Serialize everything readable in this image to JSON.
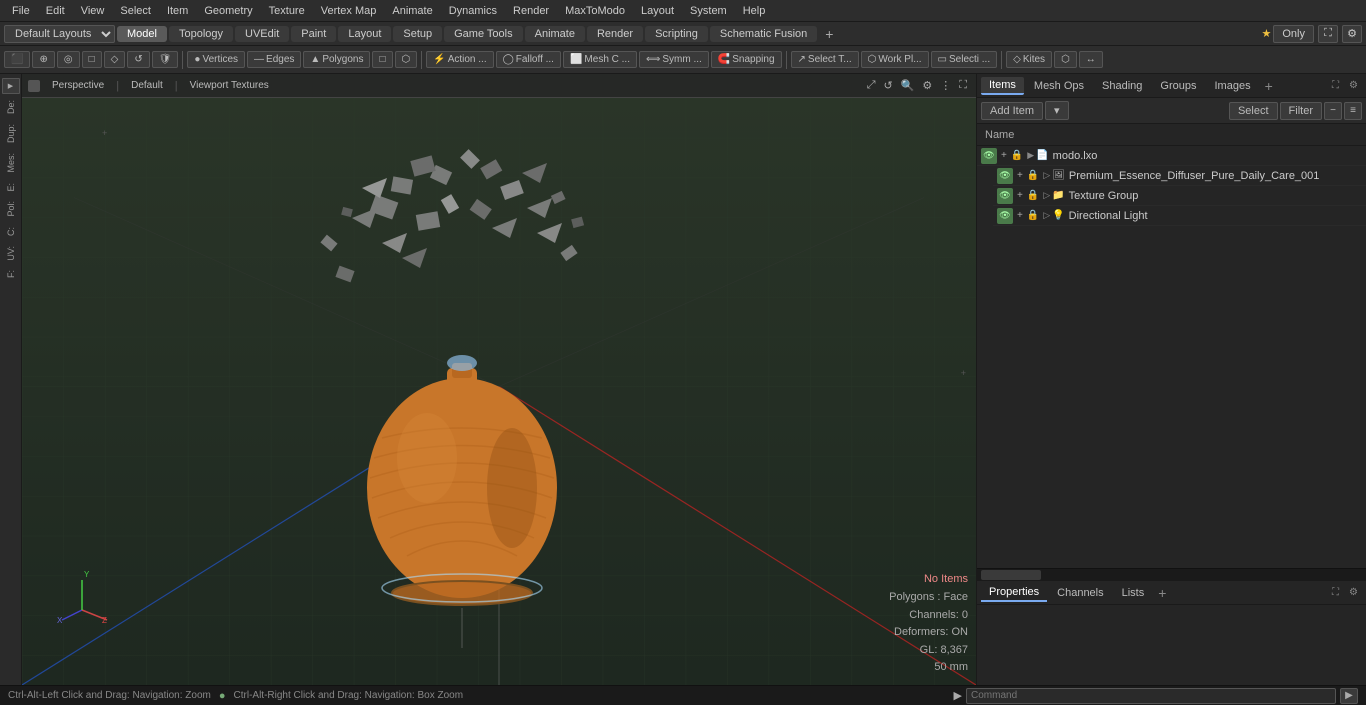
{
  "menu": {
    "items": [
      "File",
      "Edit",
      "View",
      "Select",
      "Item",
      "Geometry",
      "Texture",
      "Vertex Map",
      "Animate",
      "Dynamics",
      "Render",
      "MaxToModo",
      "Layout",
      "System",
      "Help"
    ]
  },
  "layout_bar": {
    "dropdown_label": "Default Layouts ▾",
    "tabs": [
      "Model",
      "Topology",
      "UVEdit",
      "Paint",
      "Layout",
      "Setup",
      "Game Tools",
      "Animate",
      "Render",
      "Scripting",
      "Schematic Fusion"
    ],
    "active_tab": "Model",
    "add_icon": "+",
    "star_label": "★ Only"
  },
  "toolbar": {
    "buttons": [
      {
        "label": "⬛",
        "icon": "selection-icon"
      },
      {
        "label": "⊕",
        "icon": "snapping-icon"
      },
      {
        "label": "◇",
        "icon": "falloff-icon"
      },
      {
        "label": "▭",
        "icon": "workplane-icon"
      },
      {
        "label": "Vertices",
        "icon": "vertices-icon",
        "active": false
      },
      {
        "label": "Edges",
        "icon": "edges-icon",
        "active": false
      },
      {
        "label": "Polygons",
        "icon": "polygons-icon",
        "active": false
      },
      {
        "label": "▢",
        "icon": "mode-icon"
      },
      {
        "label": "⬡",
        "icon": "mode2-icon"
      },
      {
        "label": "⊞",
        "icon": "mode3-icon"
      },
      {
        "label": "Action ...",
        "icon": "action-icon"
      },
      {
        "label": "Falloff ...",
        "icon": "falloff-dropdown-icon"
      },
      {
        "label": "Mesh C ...",
        "icon": "mesh-icon"
      },
      {
        "label": "Symm ...",
        "icon": "symmetry-icon"
      },
      {
        "label": "Snapping",
        "icon": "snapping2-icon"
      },
      {
        "label": "Select T...",
        "icon": "select-tool-icon"
      },
      {
        "label": "Work Pl...",
        "icon": "workplane2-icon"
      },
      {
        "label": "Selecti ...",
        "icon": "selecti-icon"
      },
      {
        "label": "Kites",
        "icon": "kites-icon"
      }
    ]
  },
  "viewport": {
    "header": {
      "perspective": "Perspective",
      "default": "Default",
      "viewport_textures": "Viewport Textures"
    },
    "status": {
      "no_items": "No Items",
      "polygons": "Polygons : Face",
      "channels": "Channels: 0",
      "deformers": "Deformers: ON",
      "gl": "GL: 8,367",
      "size": "50 mm"
    }
  },
  "left_sidebar": {
    "labels": [
      "De:",
      "Dup:",
      "Mes:",
      "",
      "E:",
      "Pol:",
      "C:",
      "UV:",
      "",
      "F:"
    ]
  },
  "right_panel": {
    "items_tabs": [
      "Items",
      "Mesh Ops",
      "Shading",
      "Groups",
      "Images"
    ],
    "active_items_tab": "Items",
    "toolbar": {
      "add_item": "Add Item",
      "add_item_dropdown": "▾",
      "select_btn": "Select",
      "filter_btn": "Filter"
    },
    "list_header": {
      "name_col": "Name"
    },
    "items": [
      {
        "level": 0,
        "label": "modo.lxo",
        "icon": "mesh-icon",
        "visible": true,
        "expanded": true,
        "type": "scene"
      },
      {
        "level": 1,
        "label": "Premium_Essence_Diffuser_Pure_Daily_Care_001",
        "icon": "texture-icon",
        "visible": true,
        "expanded": false,
        "type": "mesh"
      },
      {
        "level": 1,
        "label": "Texture Group",
        "icon": "texture-group-icon",
        "visible": true,
        "expanded": false,
        "type": "group"
      },
      {
        "level": 1,
        "label": "Directional Light",
        "icon": "light-icon",
        "visible": true,
        "expanded": false,
        "type": "light"
      }
    ],
    "props_tabs": [
      "Properties",
      "Channels",
      "Lists"
    ],
    "active_props_tab": "Properties"
  },
  "bottom_bar": {
    "text": "Ctrl-Alt-Left Click and Drag: Navigation: Zoom",
    "dot": "●",
    "text2": "Ctrl-Alt-Right Click and Drag: Navigation: Box Zoom",
    "command_placeholder": "Command",
    "arrow": "▶"
  },
  "colors": {
    "accent_blue": "#5a8abf",
    "active_tab_bg": "#5a5a5a",
    "bg_dark": "#1a1a1a",
    "bg_mid": "#2d2d2d",
    "bg_light": "#3a3a3a",
    "grid_line": "#2a3a2a",
    "status_red": "#e88888",
    "text_normal": "#cccccc",
    "text_dim": "#888888"
  }
}
